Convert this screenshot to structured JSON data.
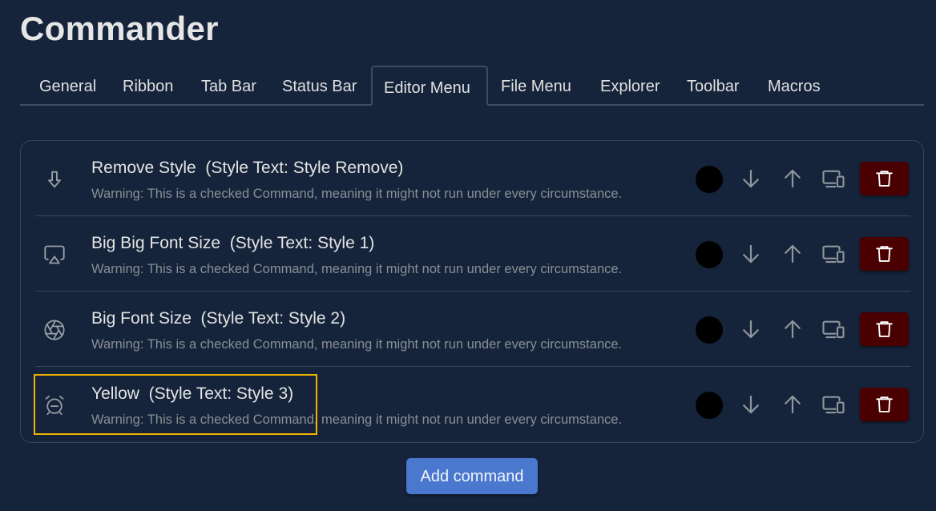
{
  "app": {
    "title": "Commander"
  },
  "tabs": [
    {
      "label": "General",
      "active": false
    },
    {
      "label": "Ribbon",
      "active": false
    },
    {
      "label": "Tab Bar",
      "active": false
    },
    {
      "label": "Status Bar",
      "active": false
    },
    {
      "label": "Editor Menu",
      "active": true
    },
    {
      "label": "File Menu",
      "active": false
    },
    {
      "label": "Explorer",
      "active": false
    },
    {
      "label": "Toolbar",
      "active": false
    },
    {
      "label": "Macros",
      "active": false
    }
  ],
  "commands": [
    {
      "name": "Remove Style",
      "detail": "(Style Text: Style Remove)",
      "label": "Remove Style  (Style Text: Style Remove)",
      "warning": "Warning: This is a checked Command, meaning it might not run under every circumstance.",
      "icon": "arrow-down-outline-icon",
      "color": "#000000"
    },
    {
      "name": "Big Big Font Size",
      "detail": "(Style Text: Style 1)",
      "label": "Big Big Font Size  (Style Text: Style 1)",
      "warning": "Warning: This is a checked Command, meaning it might not run under every circumstance.",
      "icon": "airplay-icon",
      "color": "#000000"
    },
    {
      "name": "Big Font Size",
      "detail": "(Style Text: Style 2)",
      "label": "Big Font Size  (Style Text: Style 2)",
      "warning": "Warning: This is a checked Command, meaning it might not run under every circumstance.",
      "icon": "aperture-icon",
      "color": "#000000"
    },
    {
      "name": "Yellow",
      "detail": "(Style Text: Style 3)",
      "label": "Yellow  (Style Text: Style 3)",
      "warning": "Warning: This is a checked Command, meaning it might not run under every circumstance.",
      "icon": "alarm-clock-off-icon",
      "color": "#000000"
    }
  ],
  "actions": {
    "add_command": "Add command"
  },
  "colors": {
    "background": "#15243a",
    "delete_button": "#4a0000",
    "primary_button": "#4a78cf",
    "highlight": "#f0b400"
  }
}
